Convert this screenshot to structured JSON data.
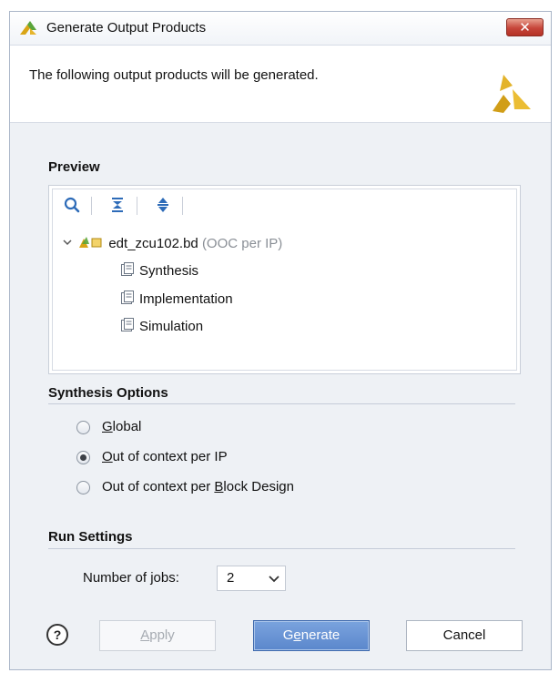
{
  "window": {
    "title": "Generate Output Products",
    "close_glyph": "✕",
    "icon": "vivado-logo-icon"
  },
  "banner": {
    "message": "The following output products will be generated.",
    "logo": "xilinx-logo-icon"
  },
  "preview": {
    "section_label": "Preview",
    "toolbar": [
      {
        "name": "search-icon",
        "label": "Search"
      },
      {
        "name": "collapse-all-icon",
        "label": "Collapse All"
      },
      {
        "name": "expand-all-icon",
        "label": "Expand All"
      }
    ],
    "tree": {
      "root_name": "edt_zcu102.bd",
      "root_suffix": "(OOC per IP)",
      "children": [
        "Synthesis",
        "Implementation",
        "Simulation"
      ]
    }
  },
  "synthesis_options": {
    "section_label": "Synthesis Options",
    "selected": "Out of context per IP",
    "options": [
      {
        "pre": "",
        "mnemonic": "G",
        "post": "lobal"
      },
      {
        "pre": "",
        "mnemonic": "O",
        "post": "ut of context per IP"
      },
      {
        "pre": "Out of context per ",
        "mnemonic": "B",
        "post": "lock Design"
      }
    ]
  },
  "run_settings": {
    "section_label": "Run Settings",
    "jobs_label_pre": "Number of ",
    "jobs_label_mnemonic": "j",
    "jobs_label_post": "obs:",
    "jobs_value": "2"
  },
  "buttons": {
    "help": "?",
    "apply_mnemonic": "A",
    "apply_rest": "pply",
    "generate_pre": "G",
    "generate_mnemonic": "e",
    "generate_post": "nerate",
    "cancel": "Cancel"
  },
  "colors": {
    "primary_button": "#5b87cc",
    "xilinx_logo": "#e3b32a",
    "dialog_background": "#eef1f5"
  }
}
